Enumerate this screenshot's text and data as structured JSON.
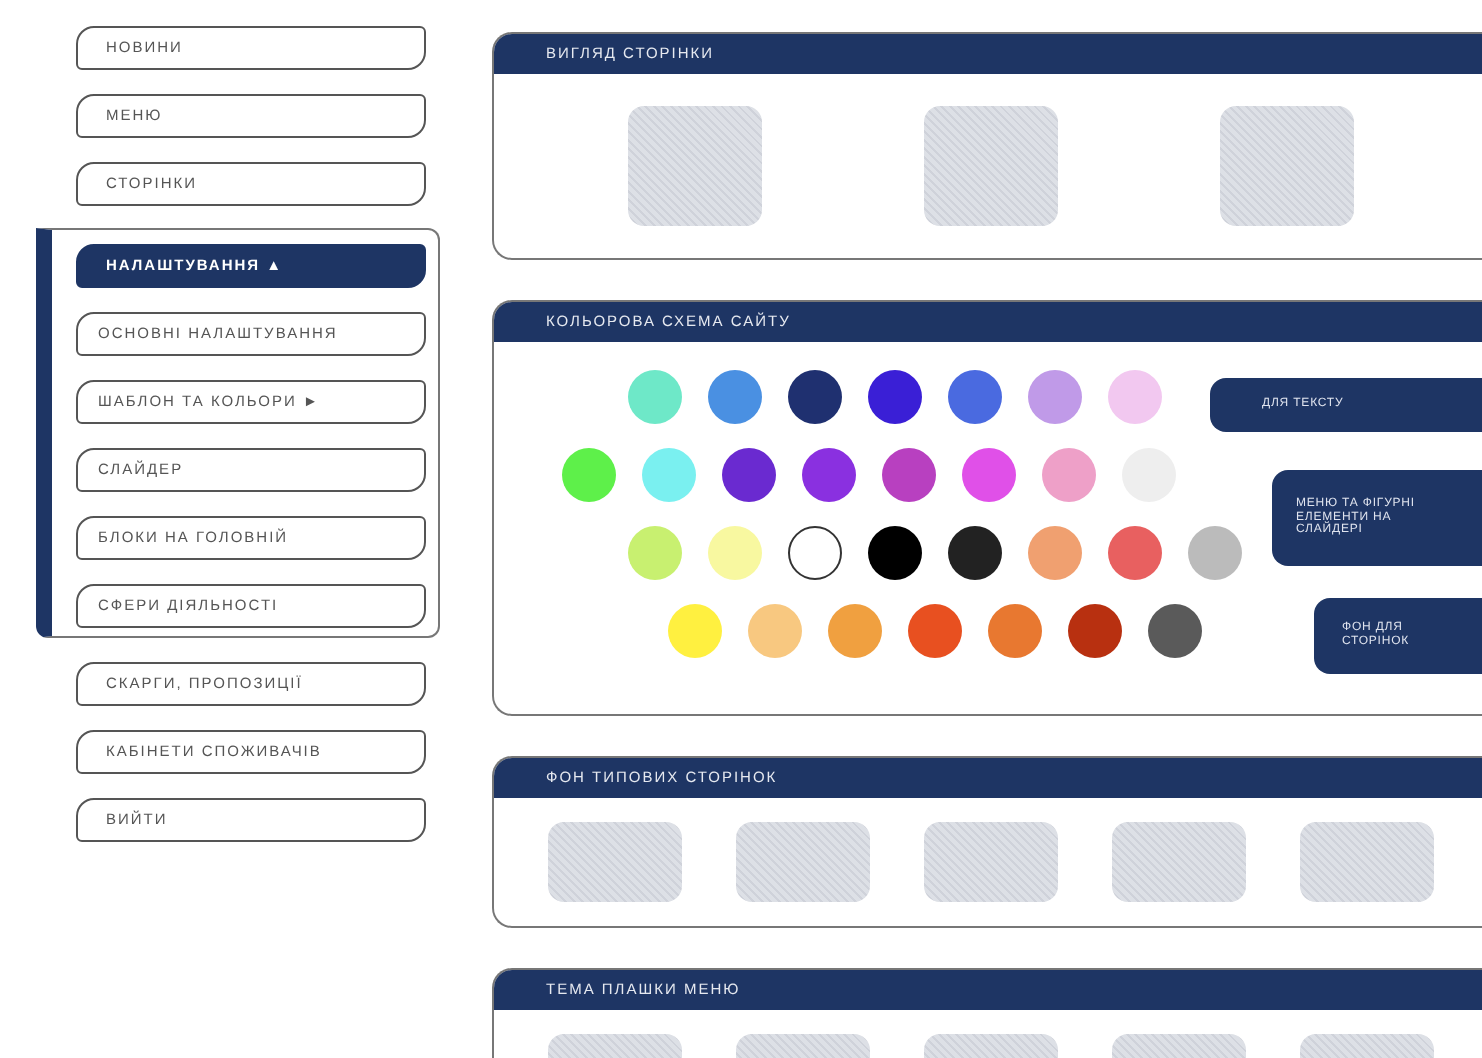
{
  "sidebar": {
    "items": [
      {
        "label": "НОВИНИ",
        "selected": false
      },
      {
        "label": "МЕНЮ",
        "selected": false
      },
      {
        "label": "СТОРІНКИ",
        "selected": false
      },
      {
        "label": "НАЛАШТУВАННЯ ▲",
        "selected": true,
        "expanded": true,
        "children": [
          {
            "label": "ОСНОВНІ НАЛАШТУВАННЯ",
            "selected": false
          },
          {
            "label": "ШАБЛОН ТА КОЛЬОРИ ►",
            "selected": false
          },
          {
            "label": "СЛАЙДЕР",
            "selected": false
          },
          {
            "label": "БЛОКИ НА ГОЛОВНІЙ",
            "selected": false
          },
          {
            "label": "СФЕРИ ДІЯЛЬНОСТІ",
            "selected": false
          }
        ]
      },
      {
        "label": "СКАРГИ, ПРОПОЗИЦІЇ",
        "selected": false
      },
      {
        "label": "КАБІНЕТИ СПОЖИВАЧІВ",
        "selected": false
      },
      {
        "label": "ВИЙТИ",
        "selected": false
      }
    ]
  },
  "panels": [
    {
      "kind": "thumbnails",
      "title": "ВИГЛЯД СТОРІНКИ",
      "thumbnails": [
        {
          "kind": "placeholder"
        },
        {
          "kind": "placeholder"
        },
        {
          "kind": "placeholder"
        }
      ]
    },
    {
      "kind": "colors",
      "title": "КОЛЬОРОВА СХЕМА САЙТУ",
      "swatch_rows": [
        [
          {
            "color": "#6ee8c8"
          },
          {
            "color": "#4a90e2"
          },
          {
            "color": "#1f3070"
          },
          {
            "color": "#3a1fd6"
          },
          {
            "color": "#4a6ae0"
          },
          {
            "color": "#c09ae8"
          },
          {
            "color": "#f2c8f0"
          }
        ],
        [
          {
            "color": "#5ef04a"
          },
          {
            "color": "#7af0f0"
          },
          {
            "color": "#6a2ad0"
          },
          {
            "color": "#8a30e0"
          },
          {
            "color": "#b840c0"
          },
          {
            "color": "#e050e8"
          },
          {
            "color": "#eea0c8"
          },
          {
            "color": "#eeeeee"
          }
        ],
        [
          {
            "color": "#c8f070"
          },
          {
            "color": "#f8f8a0"
          },
          {
            "color": "#ffffff"
          },
          {
            "color": "#000000"
          },
          {
            "color": "#222222"
          },
          {
            "color": "#f0a070"
          },
          {
            "color": "#e86060"
          },
          {
            "color": "#bbbbbb"
          }
        ],
        [
          {
            "color": "#fff040"
          },
          {
            "color": "#f8c880"
          },
          {
            "color": "#f0a040"
          },
          {
            "color": "#e85020"
          },
          {
            "color": "#e87830"
          },
          {
            "color": "#b83010"
          },
          {
            "color": "#5a5a5a"
          }
        ]
      ],
      "buttons": [
        "ДЛЯ ТЕКСТУ",
        "МЕНЮ ТА ФІГУРНІ ЕЛЕМЕНТИ НА СЛАЙДЕРІ",
        "ФОН ДЛЯ СТОРІНОК"
      ]
    },
    {
      "kind": "thumbnails",
      "title": "ФОН ТИПОВИХ СТОРІНОК",
      "thumbnails": [
        {
          "kind": "placeholder"
        },
        {
          "kind": "placeholder"
        },
        {
          "kind": "placeholder"
        },
        {
          "kind": "placeholder"
        },
        {
          "kind": "placeholder"
        }
      ]
    },
    {
      "kind": "thumbnails",
      "title": "ТЕМА ПЛАШКИ МЕНЮ",
      "thumbnails": [
        {
          "kind": "placeholder"
        },
        {
          "kind": "placeholder"
        },
        {
          "kind": "placeholder"
        },
        {
          "kind": "placeholder"
        },
        {
          "kind": "placeholder"
        }
      ]
    }
  ]
}
